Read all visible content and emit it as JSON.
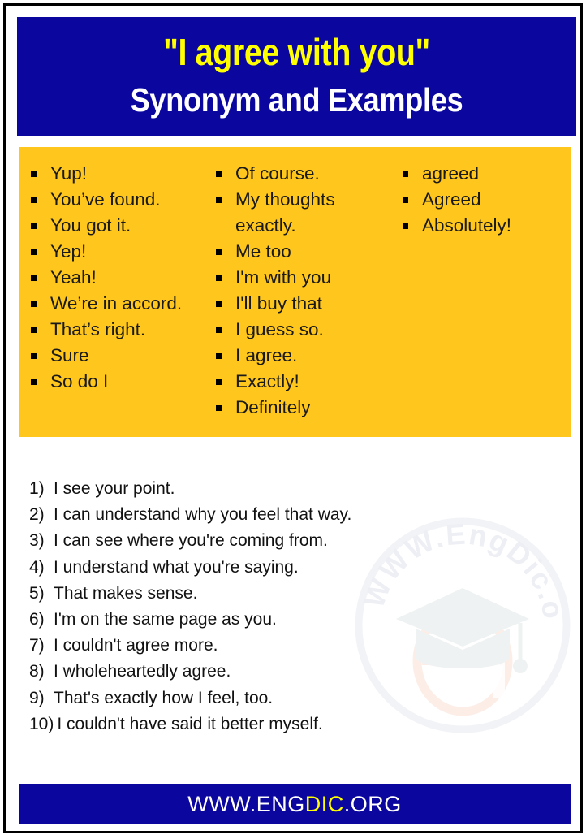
{
  "colors": {
    "blue": "#0a069e",
    "yellow_panel": "#ffc61e",
    "title_yellow": "#ffff00",
    "white": "#ffffff",
    "black": "#000000",
    "watermark_grey": "#e6e9ef",
    "watermark_peach": "#fbe3d8"
  },
  "header": {
    "title": "\"I agree with you\"",
    "subtitle": "Synonym and Examples"
  },
  "synonyms": {
    "columns": [
      {
        "items": [
          "Yup!",
          "You’ve found.",
          "You got it.",
          "Yep!",
          "Yeah!",
          "We’re in accord.",
          "That’s right.",
          "Sure",
          "So do I"
        ]
      },
      {
        "items": [
          "Of course.",
          "My thoughts exactly.",
          "Me too",
          "I'm with you",
          "I'll buy that",
          "I guess so.",
          "I agree.",
          "Exactly!",
          "Definitely"
        ]
      },
      {
        "items": [
          "agreed",
          "Agreed",
          "Absolutely!"
        ]
      }
    ]
  },
  "examples": {
    "items": [
      {
        "num": "1)",
        "text": "I see your point."
      },
      {
        "num": "2)",
        "text": "I can understand why you feel that way."
      },
      {
        "num": "3)",
        "text": "I can see where you're coming from."
      },
      {
        "num": "4)",
        "text": "I understand what you're saying."
      },
      {
        "num": "5)",
        "text": "That makes sense."
      },
      {
        "num": "6)",
        "text": "I'm on the same page as you."
      },
      {
        "num": "7)",
        "text": "I couldn't agree more."
      },
      {
        "num": "8)",
        "text": "I wholeheartedly agree."
      },
      {
        "num": "9)",
        "text": "That's exactly how I feel, too."
      },
      {
        "num": "10)",
        "text": "I couldn't have said it better myself."
      }
    ]
  },
  "footer": {
    "prefix": "WWW.ENG",
    "accent": "DIC",
    "suffix": ".ORG"
  },
  "watermark": {
    "curved_text": "WWW.EngDic.org",
    "letter": "e"
  }
}
